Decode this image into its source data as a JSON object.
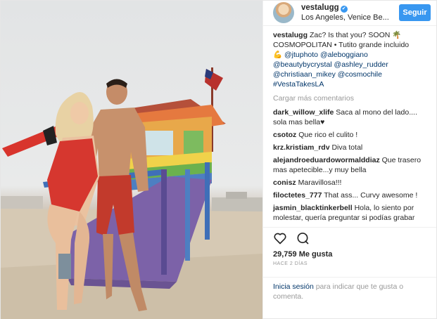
{
  "header": {
    "username": "vestalugg",
    "verified_mark": "✔",
    "location": "Los Angeles, Venice Be...",
    "follow_label": "Seguir"
  },
  "caption": {
    "username": "vestalugg",
    "text_1": "Zac? Is that you? SOON",
    "emoji_1": "🌴",
    "text_2": "COSMOPOLITAN • Tutito grande incluido",
    "emoji_2": "💪",
    "mentions": [
      "@jtuphoto",
      "@aleboggiano",
      "@beautybycrystal",
      "@ashley_rudder",
      "@christiaan_mikey",
      "@cosmochile"
    ],
    "hashtag": "#VestaTakesLA"
  },
  "load_more": "Cargar más comentarios",
  "comments": [
    {
      "user": "dark_willow_xlife",
      "text": "Saca al mono del lado.... sola mas bella♥"
    },
    {
      "user": "csotoz",
      "text": "Que rico el culito !"
    },
    {
      "user": "krz.kristiam_rdv",
      "text": "Diva total"
    },
    {
      "user": "alejandroeduardowormalddiaz",
      "text": "Que trasero mas apetecible...y muy bella"
    },
    {
      "user": "conisz",
      "text": "Maravillosa!!!"
    },
    {
      "user": "filoctetes_777",
      "text": "That ass... Curvy awesome !"
    },
    {
      "user": "jasmin_blacktinkerbell",
      "text": "Hola, lo siento por molestar, quería preguntar si podías grabar"
    }
  ],
  "actions": {
    "like_icon": "heart-icon",
    "comment_icon": "comment-icon",
    "likes": "29,759 Me gusta",
    "time": "HACE 2 DÍAS"
  },
  "login": {
    "link": "Inicia sesión",
    "text": "para indicar que te gusta o comenta."
  }
}
